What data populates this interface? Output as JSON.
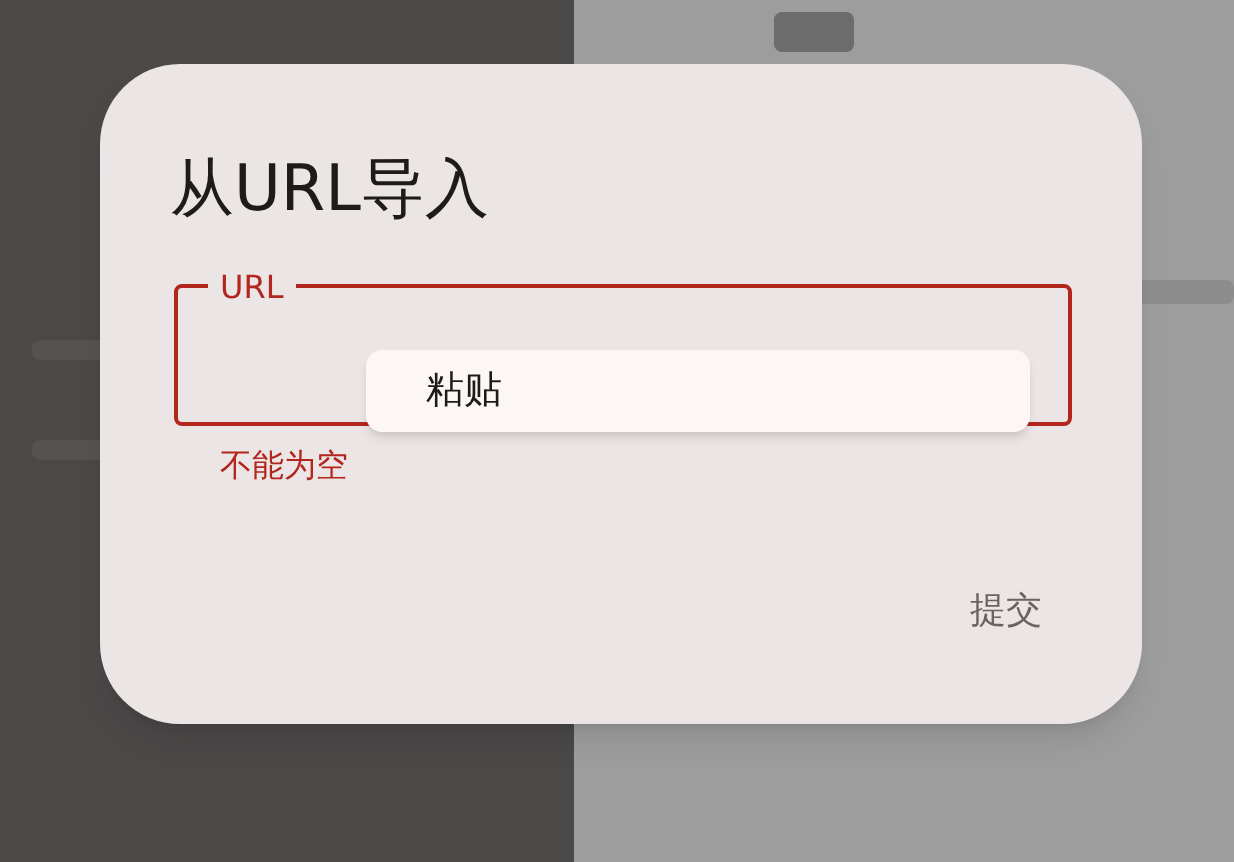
{
  "dialog": {
    "title": "从URL导入",
    "field": {
      "label": "URL",
      "invalid": true,
      "error": "不能为空"
    },
    "context_menu": {
      "items": [
        {
          "label": "粘贴"
        }
      ]
    },
    "buttons": [
      {
        "label": "提交"
      }
    ]
  }
}
